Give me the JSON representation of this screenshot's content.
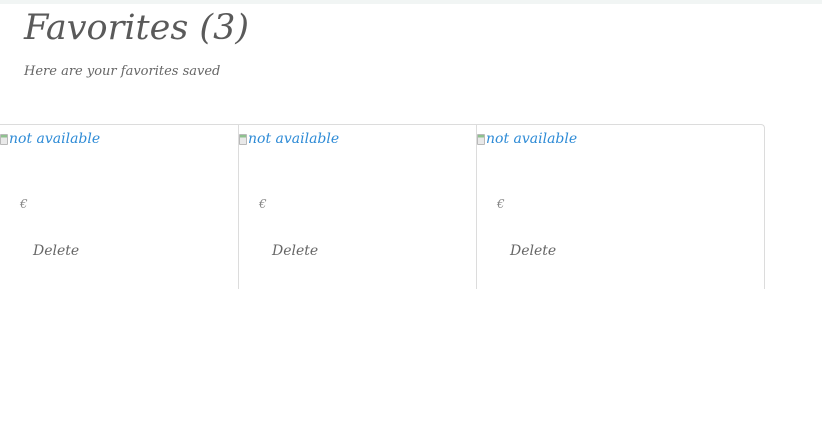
{
  "header": {
    "title": "Favorites (3)",
    "subtitle": "Here are your favorites saved"
  },
  "favorites": [
    {
      "image_alt": "not available",
      "price": "€",
      "delete_label": "Delete"
    },
    {
      "image_alt": "not available",
      "price": "€",
      "delete_label": "Delete"
    },
    {
      "image_alt": "not available",
      "price": "€",
      "delete_label": "Delete"
    }
  ],
  "colors": {
    "title": "#5a5a5a",
    "link": "#2e8bd6",
    "border": "#dcdcdc"
  }
}
